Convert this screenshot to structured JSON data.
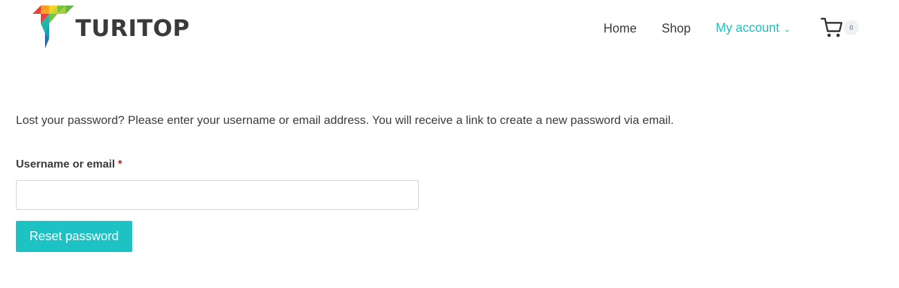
{
  "brand": {
    "name": "TURITOP",
    "colors": {
      "red": "#e8413a",
      "orange": "#f29d22",
      "yellow": "#f6d528",
      "green": "#7ac143",
      "teal": "#20b2aa",
      "blue": "#2b6db3"
    }
  },
  "nav": {
    "items": [
      {
        "label": "Home"
      },
      {
        "label": "Shop"
      },
      {
        "label": "My account",
        "active": true
      }
    ],
    "cart": {
      "icon": "cart-icon",
      "count": "0"
    }
  },
  "main": {
    "intro": "Lost your password? Please enter your username or email address. You will receive a link to create a new password via email.",
    "field": {
      "label": "Username or email",
      "required_mark": "*",
      "value": "",
      "placeholder": ""
    },
    "submit_label": "Reset password"
  },
  "theme": {
    "accent": "#1cc2c4",
    "required": "#e2161b",
    "text": "#3a3a3a"
  }
}
